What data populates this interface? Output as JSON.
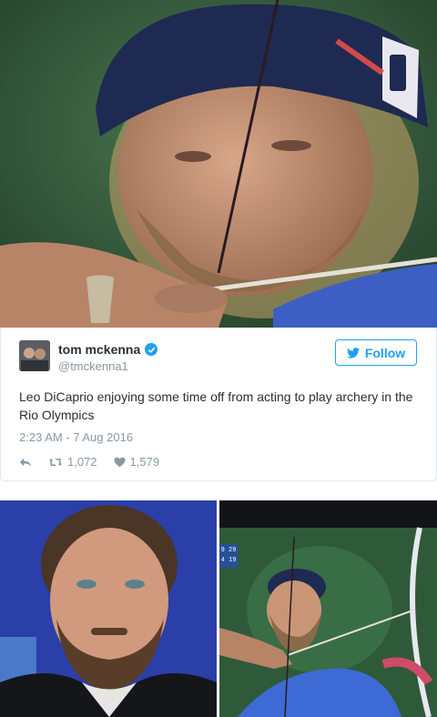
{
  "tweet": {
    "display_name": "tom mckenna",
    "handle": "@tmckenna1",
    "follow_label": "Follow",
    "text": "Leo DiCaprio enjoying some time off from acting to play archery in the Rio Olympics",
    "timestamp": "2:23 AM - 7 Aug 2016",
    "retweets": "1,072",
    "likes": "1,579"
  },
  "scoreboard": {
    "line1": "9 29",
    "line2": "4 19"
  },
  "colors": {
    "accent": "#1da1f2",
    "text": "#292f33",
    "muted": "#8899a6"
  },
  "icons": {
    "verified": "verified-badge-icon",
    "follow": "twitter-bird-icon",
    "reply": "reply-icon",
    "retweet": "retweet-icon",
    "like": "heart-icon"
  }
}
